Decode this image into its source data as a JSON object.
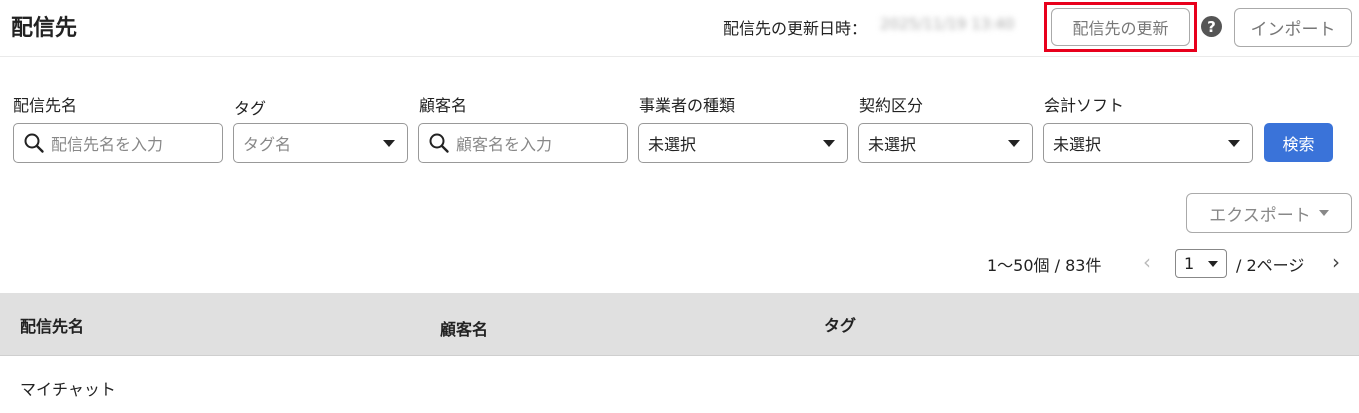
{
  "header": {
    "title": "配信先",
    "updated_label": "配信先の更新日時：",
    "updated_value": "2025/11/19 13:40",
    "refresh_button": "配信先の更新",
    "help_icon": "?",
    "import_button": "インポート",
    "highlight_color": "#e8001c"
  },
  "filters": {
    "destination": {
      "label": "配信先名",
      "placeholder": "配信先名を入力"
    },
    "tag": {
      "label": "タグ",
      "placeholder": "タグ名"
    },
    "customer": {
      "label": "顧客名",
      "placeholder": "顧客名を入力"
    },
    "business_type": {
      "label": "事業者の種類",
      "value": "未選択"
    },
    "contract": {
      "label": "契約区分",
      "value": "未選択"
    },
    "accounting": {
      "label": "会計ソフト",
      "value": "未選択"
    },
    "search_button": "検索",
    "accent_color": "#3a73d9"
  },
  "export_button": "エクスポート",
  "pagination": {
    "range": "1〜50個 / 83件",
    "prev": "‹",
    "page": "1",
    "total": "/ 2ページ",
    "next": "›"
  },
  "table": {
    "columns": [
      "配信先名",
      "顧客名",
      "タグ"
    ],
    "rows": [
      {
        "destination": "マイチャット",
        "customer": "",
        "tag": ""
      }
    ]
  }
}
